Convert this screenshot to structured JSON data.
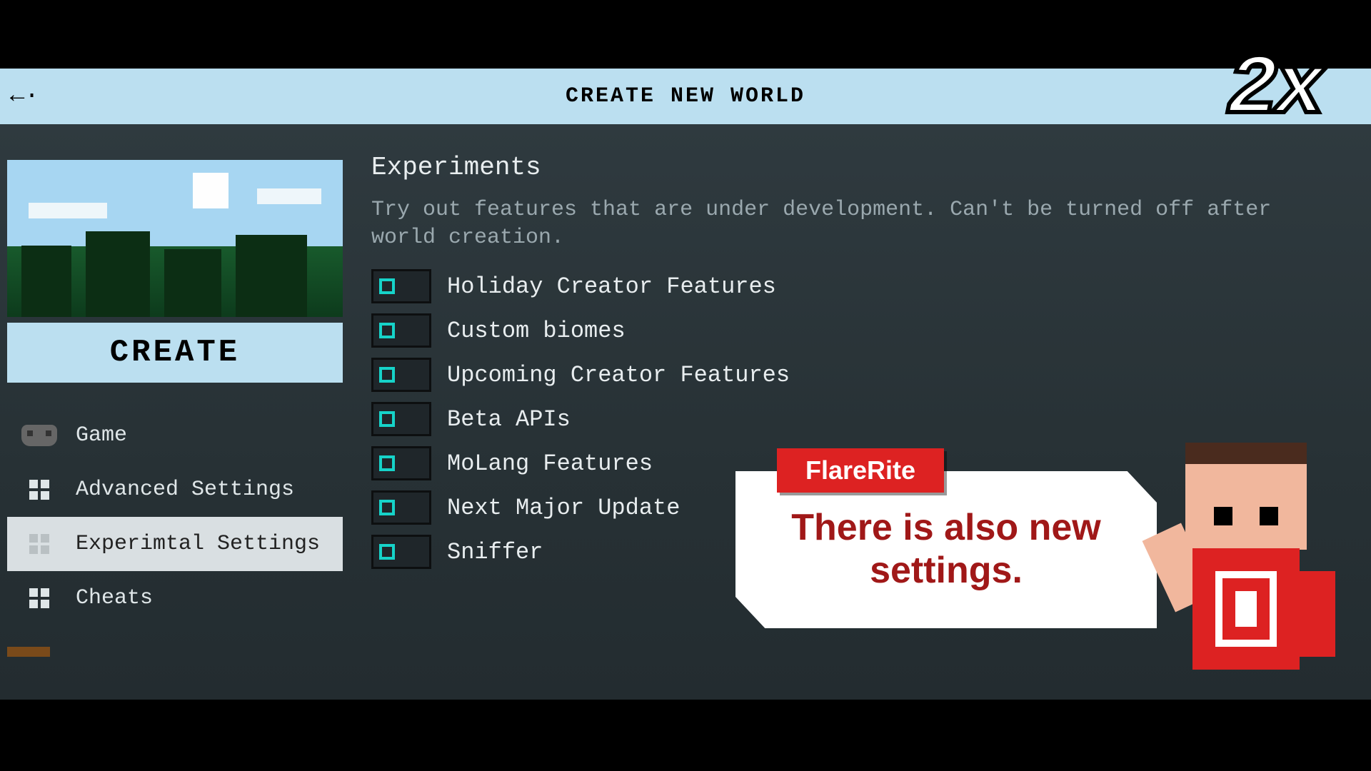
{
  "header": {
    "title": "CREATE NEW WORLD"
  },
  "sidebar": {
    "create_label": "CREATE",
    "items": [
      {
        "label": "Game"
      },
      {
        "label": "Advanced Settings"
      },
      {
        "label": "Experimtal Settings"
      },
      {
        "label": "Cheats"
      }
    ]
  },
  "content": {
    "section_title": "Experiments",
    "section_desc": "Try out features that are under development. Can't be turned off after world creation.",
    "options": [
      {
        "label": "Holiday Creator Features"
      },
      {
        "label": "Custom biomes"
      },
      {
        "label": "Upcoming Creator Features"
      },
      {
        "label": "Beta APIs"
      },
      {
        "label": "MoLang Features"
      },
      {
        "label": "Next Major Update"
      },
      {
        "label": "Sniffer"
      }
    ]
  },
  "overlay": {
    "branding_badge": "2x",
    "author": "FlareRite",
    "speech": "There is also new settings."
  }
}
